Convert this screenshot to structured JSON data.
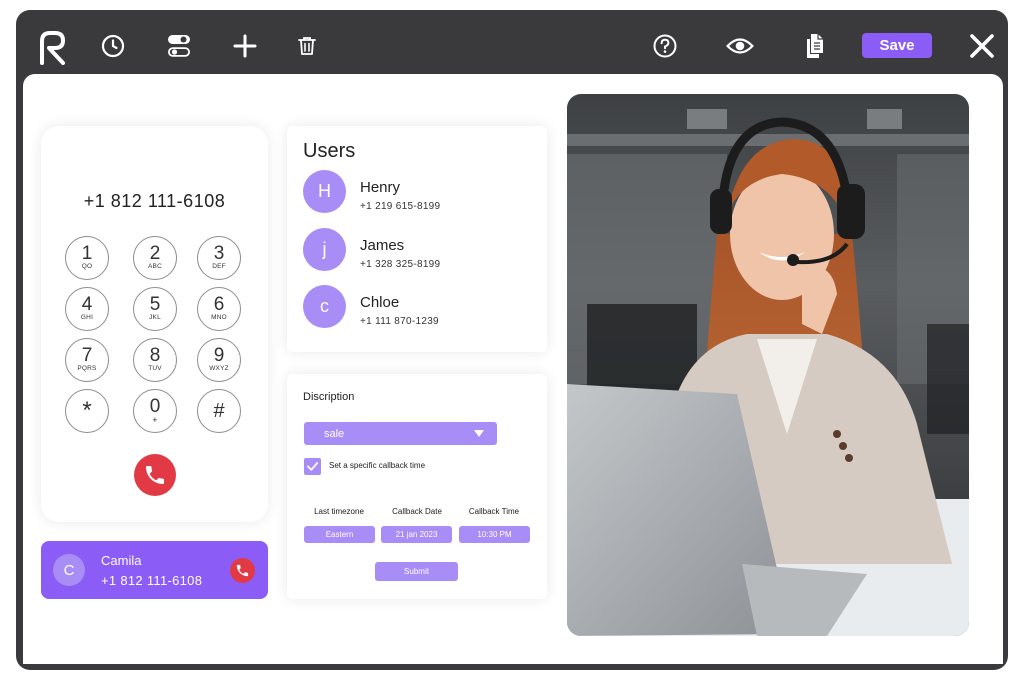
{
  "toolbar": {
    "logo": "R",
    "save_label": "Save"
  },
  "dialer": {
    "number": "+1 812 111-6108",
    "keys": [
      {
        "digit": "1",
        "letters": "QO"
      },
      {
        "digit": "2",
        "letters": "ABC"
      },
      {
        "digit": "3",
        "letters": "DEF"
      },
      {
        "digit": "4",
        "letters": "GHI"
      },
      {
        "digit": "5",
        "letters": "JKL"
      },
      {
        "digit": "6",
        "letters": "MNO"
      },
      {
        "digit": "7",
        "letters": "PQRS"
      },
      {
        "digit": "8",
        "letters": "TUV"
      },
      {
        "digit": "9",
        "letters": "WXYZ"
      },
      {
        "digit": "*",
        "letters": ""
      },
      {
        "digit": "0",
        "letters": "+"
      },
      {
        "digit": "#",
        "letters": ""
      }
    ]
  },
  "active_call": {
    "initial": "C",
    "name": "Camila",
    "number": "+1 812 111-6108"
  },
  "users": {
    "title": "Users",
    "items": [
      {
        "initial": "H",
        "name": "Henry",
        "phone": "+1 219 615-8199"
      },
      {
        "initial": "j",
        "name": "James",
        "phone": "+1 328 325-8199"
      },
      {
        "initial": "c",
        "name": "Chloe",
        "phone": "+1 111 870-1239"
      }
    ]
  },
  "form": {
    "label": "Discription",
    "select_value": "sale",
    "callback_checkbox_label": "Set a specific callback time",
    "callback_checked": true,
    "columns": [
      {
        "label": "Last timezone",
        "value": "Eastern"
      },
      {
        "label": "Callback Date",
        "value": "21 jan 2023"
      },
      {
        "label": "Callback Time",
        "value": "10:30 PM"
      }
    ],
    "submit_label": "Submit"
  },
  "colors": {
    "accent": "#8b5cf6",
    "accent_light": "#a98df6",
    "danger": "#e23a44",
    "toolbar_bg": "#3a3a3c"
  }
}
